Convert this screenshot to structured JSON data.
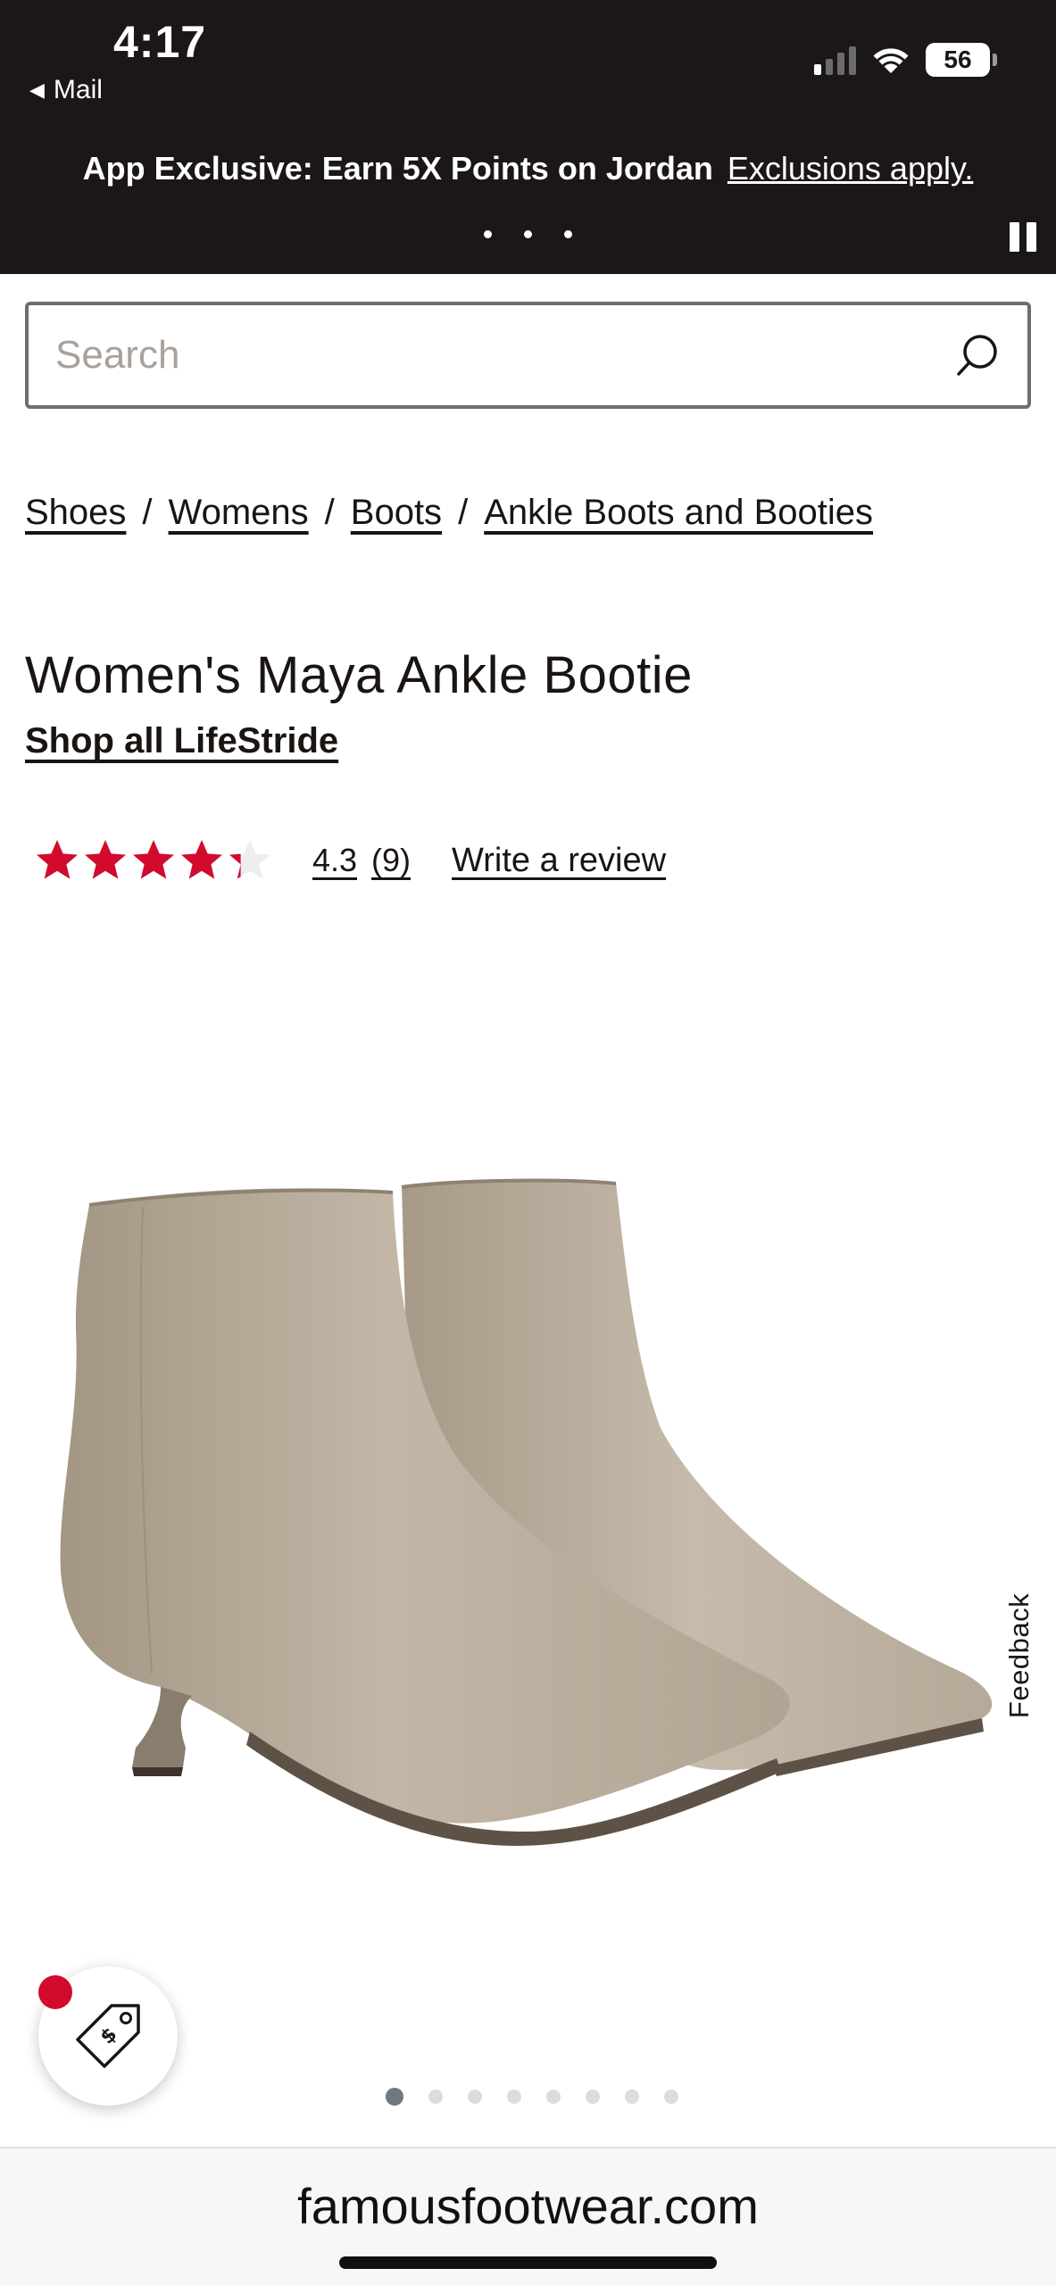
{
  "status_bar": {
    "time": "4:17",
    "back_app": "Mail",
    "battery_level": "56",
    "signal_bars_active": 1,
    "signal_bars_total": 4
  },
  "promo": {
    "text": "App Exclusive: Earn 5X Points on Jordan",
    "link": "Exclusions apply.",
    "slide_count": 3
  },
  "search": {
    "placeholder": "Search",
    "icon": "search-icon"
  },
  "breadcrumb": [
    "Shoes",
    "Womens",
    "Boots",
    "Ankle Boots and Booties"
  ],
  "product": {
    "title": "Women's Maya Ankle Bootie",
    "brand_link": "Shop all LifeStride",
    "rating_value": "4.3",
    "rating_count": "(9)",
    "rating_fraction": 0.86,
    "write_review": "Write a review",
    "image_count": 8,
    "active_image": 1
  },
  "feedback": {
    "label": "Feedback"
  },
  "deals": {
    "icon": "price-tag-icon"
  },
  "url_bar": {
    "domain": "famousfootwear.com"
  },
  "colors": {
    "top_bar": "#1b1716",
    "star": "#d20a2e",
    "badge": "#d20a2e",
    "boot": "#b8aa9a"
  }
}
